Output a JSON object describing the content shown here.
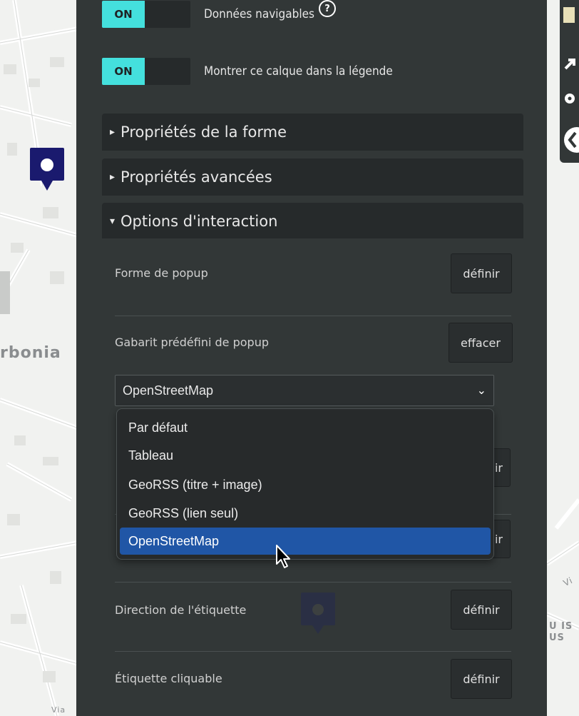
{
  "map": {
    "labels": [
      {
        "text": "rbonia"
      },
      {
        "text": "U IS"
      },
      {
        "text": "US"
      },
      {
        "text": "Via"
      },
      {
        "text": "Vi"
      }
    ]
  },
  "toggles": [
    {
      "state": "ON",
      "label": "Données navigables",
      "help": "?"
    },
    {
      "state": "ON",
      "label": "Montrer ce calque dans la légende"
    }
  ],
  "sections": [
    {
      "arrow": "▸",
      "title": "Propriétés de la forme"
    },
    {
      "arrow": "▸",
      "title": "Propriétés avancées"
    },
    {
      "arrow": "▾",
      "title": "Options d'interaction"
    }
  ],
  "fields": {
    "popup_shape": {
      "label": "Forme de popup",
      "button": "définir"
    },
    "popup_template": {
      "label": "Gabarit prédéfini de popup",
      "button": "effacer"
    },
    "hidden_button_1": "ir",
    "hidden_button_2": "ir",
    "label_direction": {
      "label": "Direction de l'étiquette",
      "button": "définir"
    },
    "clickable_label": {
      "label": "Étiquette cliquable",
      "button": "définir"
    }
  },
  "select": {
    "value": "OpenStreetMap",
    "chevron": "⌄",
    "options": [
      "Par défaut",
      "Tableau",
      "GeoRSS (titre + image)",
      "GeoRSS (lien seul)",
      "OpenStreetMap"
    ],
    "selected_index": 4
  },
  "colors": {
    "panel": "#323737",
    "toggle_on": "#44e0dd",
    "selected_option": "#2056a6",
    "marker": "#1a1a6e"
  }
}
